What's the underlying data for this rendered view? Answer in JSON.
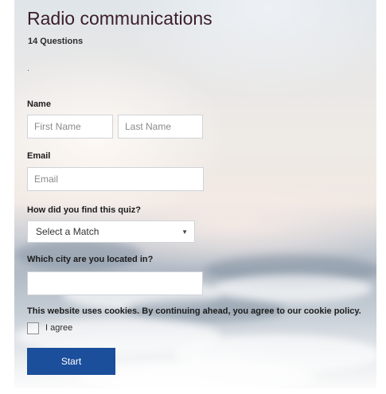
{
  "quiz": {
    "title": "Radio communications",
    "question_count": "14 Questions",
    "description": "."
  },
  "form": {
    "name_label": "Name",
    "first_name_placeholder": "First Name",
    "last_name_placeholder": "Last Name",
    "email_label": "Email",
    "email_placeholder": "Email",
    "source_label": "How did you find this quiz?",
    "source_selected": "Select a Match",
    "city_label": "Which city are you located in?",
    "city_value": "",
    "cookie_notice": "This website uses cookies. By continuing ahead, you agree to our cookie policy.",
    "agree_label": "I agree",
    "agree_checked": false,
    "start_label": "Start"
  },
  "colors": {
    "title": "#3a1e28",
    "start_button": "#1b4e9b"
  },
  "icons": {
    "dropdown": "chevron-down-icon"
  }
}
